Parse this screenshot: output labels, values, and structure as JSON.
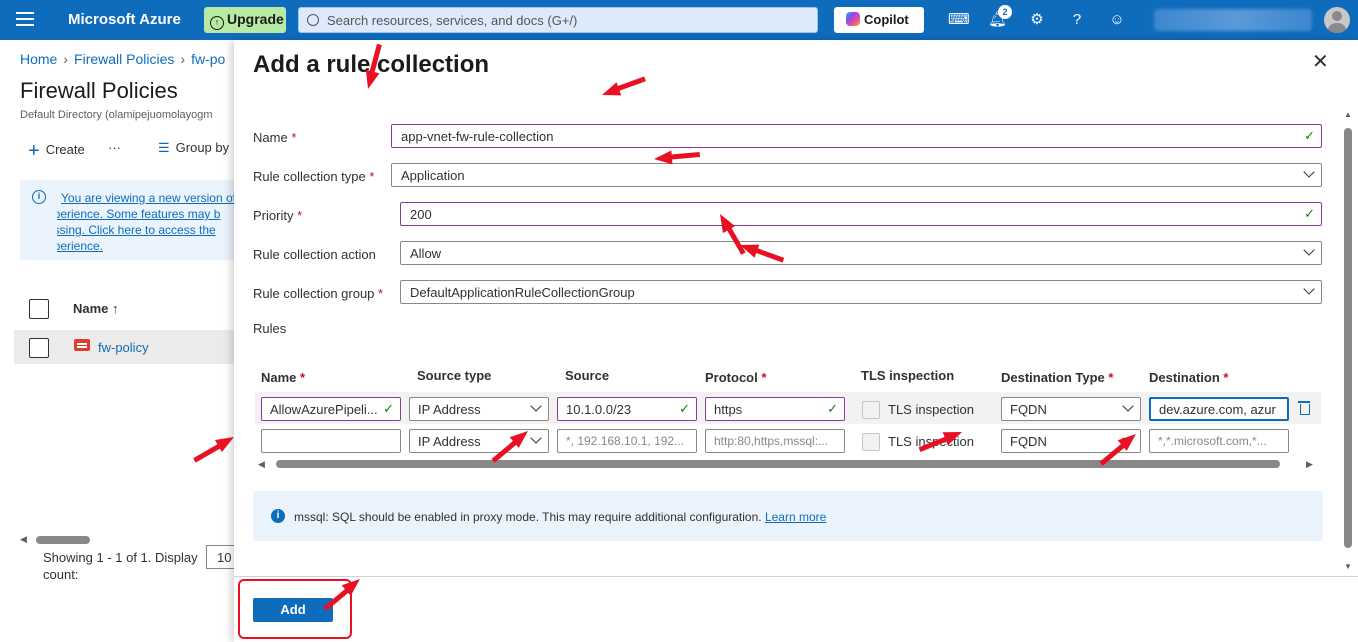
{
  "topbar": {
    "brand": "Microsoft Azure",
    "upgrade": "Upgrade",
    "search_placeholder": "Search resources, services, and docs (G+/)",
    "copilot": "Copilot",
    "notification_count": "2"
  },
  "background": {
    "breadcrumb": [
      "Home",
      "Firewall Policies",
      "fw-po"
    ],
    "title": "Firewall Policies",
    "subtitle": "Default Directory (olamipejuomolayogm",
    "commands": {
      "create": "Create",
      "more": "···",
      "group_by": "Group by"
    },
    "info_text": "You are viewing a new version of experience. Some features may be missing. Click here to access the experience.",
    "info_lines": [
      "You are viewing a new version of",
      "experience. Some features may b",
      "missing. Click here to access the",
      "experience."
    ],
    "list_header": "Name ↑",
    "list_item": "fw-policy",
    "showing": "Showing 1 - 1 of 1. Display count:",
    "page_size": "10"
  },
  "panel": {
    "title": "Add a rule collection",
    "close": "✕",
    "fields": {
      "name": {
        "label": "Name",
        "value": "app-vnet-fw-rule-collection"
      },
      "type": {
        "label": "Rule collection type",
        "value": "Application"
      },
      "priority": {
        "label": "Priority",
        "value": "200"
      },
      "action": {
        "label": "Rule collection action",
        "value": "Allow"
      },
      "group": {
        "label": "Rule collection group",
        "value": "DefaultApplicationRuleCollectionGroup"
      }
    },
    "rules_label": "Rules",
    "required_mark": "*",
    "columns": {
      "name": "Name",
      "source_type": "Source type",
      "source": "Source",
      "protocol": "Protocol",
      "tls": "TLS inspection",
      "dest_type": "Destination Type",
      "destination": "Destination"
    },
    "rows": [
      {
        "name": "AllowAzurePipeli...",
        "source_type": "IP Address",
        "source": "10.1.0.0/23",
        "protocol": "https",
        "tls": "TLS inspection",
        "dest_type": "FQDN",
        "destination": "dev.azure.com, azur"
      },
      {
        "name": "",
        "source_type": "IP Address",
        "source_placeholder": "*, 192.168.10.1, 192...",
        "protocol_placeholder": "http:80,https,mssql:...",
        "tls": "TLS inspection",
        "dest_type": "FQDN",
        "destination_placeholder": "*,*.microsoft.com,*..."
      }
    ],
    "note": "mssql: SQL should be enabled in proxy mode. This may require additional configuration.",
    "note_link": "Learn more",
    "add_button": "Add"
  },
  "colors": {
    "accent": "#0f6cbd",
    "annotation": "#e81123",
    "valid_border": "#8a3a9e"
  }
}
